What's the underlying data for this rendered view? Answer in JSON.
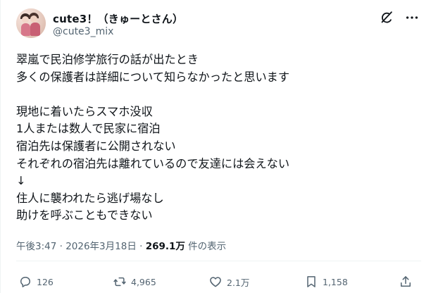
{
  "author": {
    "display_name": "cute3！（きゅーとさん）",
    "handle": "@cute3_mix"
  },
  "post": {
    "text": "翠嵐で民泊修学旅行の話が出たとき\n多くの保護者は詳細について知らなかったと思います\n\n現地に着いたらスマホ没収\n1人または数人で民家に宿泊\n宿泊先は保護者に公開されない\nそれぞれの宿泊先は離れているので友達には会えない\n↓\n住人に襲われたら逃げ場なし\n助けを呼ぶこともできない"
  },
  "meta": {
    "timestamp": "午後3:47 · 2026年3月18日 · ",
    "views": "269.1万",
    "views_suffix": " 件の表示"
  },
  "actions": {
    "replies": "126",
    "reposts": "4,965",
    "likes": "2.1万",
    "bookmarks": "1,158"
  },
  "icons": {
    "header": [
      "grok-icon",
      "more-icon"
    ],
    "actions": [
      "reply-icon",
      "repost-icon",
      "like-icon",
      "bookmark-icon",
      "share-icon"
    ]
  },
  "colors": {
    "text": "#0f1419",
    "secondary": "#536471",
    "divider": "#eff3f4"
  }
}
